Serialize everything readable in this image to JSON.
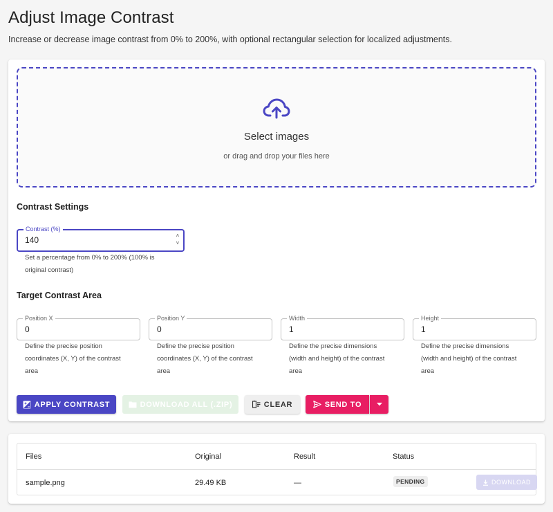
{
  "page": {
    "title": "Adjust Image Contrast",
    "description": "Increase or decrease image contrast from 0% to 200%, with optional rectangular selection for localized adjustments."
  },
  "dropzone": {
    "icon": "cloud-upload-icon",
    "title": "Select images",
    "subtitle": "or drag and drop your files here"
  },
  "contrast_settings": {
    "heading": "Contrast Settings",
    "field": {
      "label": "Contrast (%)",
      "value": "140",
      "helper_line1": "Set a percentage from 0% to 200% (100% is",
      "helper_line2": "original contrast)"
    }
  },
  "target_area": {
    "heading": "Target Contrast Area",
    "fields": [
      {
        "label": "Position X",
        "value": "0",
        "helper": [
          "Define the precise position",
          "coordinates (X, Y) of the contrast",
          "area"
        ]
      },
      {
        "label": "Position Y",
        "value": "0",
        "helper": [
          "Define the precise position",
          "coordinates (X, Y) of the contrast",
          "area"
        ]
      },
      {
        "label": "Width",
        "value": "1",
        "helper": [
          "Define the precise dimensions",
          "(width and height) of the contrast",
          "area"
        ]
      },
      {
        "label": "Height",
        "value": "1",
        "helper": [
          "Define the precise dimensions",
          "(width and height) of the contrast",
          "area"
        ]
      }
    ]
  },
  "actions": {
    "apply": "APPLY CONTRAST",
    "download_all": "DOWNLOAD ALL (.ZIP)",
    "clear": "CLEAR",
    "send_to": "SEND TO"
  },
  "files_table": {
    "columns": [
      "Files",
      "Original",
      "Result",
      "Status"
    ],
    "rows": [
      {
        "file": "sample.png",
        "original": "29.49 KB",
        "result": "—",
        "status": "PENDING",
        "download": "DOWNLOAD"
      }
    ]
  },
  "colors": {
    "primary": "#4a46c4",
    "secondary": "#e81e63",
    "disabled_green": "#e4f2e4",
    "disabled_primary": "#d8d7f2"
  }
}
